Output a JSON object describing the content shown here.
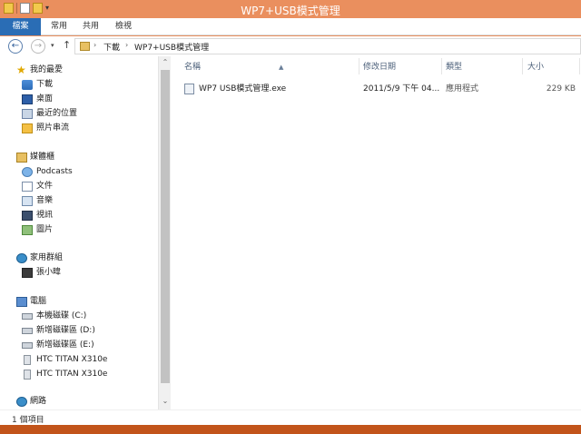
{
  "window": {
    "title": "WP7+USB模式管理"
  },
  "ribbon": {
    "tabs": [
      "檔案",
      "常用",
      "共用",
      "檢視"
    ]
  },
  "address": {
    "crumbs": [
      "下載",
      "WP7+USB模式管理"
    ]
  },
  "nav": {
    "favorites": {
      "header": "我的最愛",
      "items": [
        "下載",
        "桌面",
        "最近的位置",
        "照片串流"
      ]
    },
    "libraries": {
      "header": "媒體櫃",
      "items": [
        "Podcasts",
        "文件",
        "音樂",
        "視訊",
        "圖片"
      ]
    },
    "homegroup": {
      "header": "家用群組",
      "items": [
        "張小暐"
      ]
    },
    "computer": {
      "header": "電腦",
      "items": [
        "本機磁碟 (C:)",
        "新增磁碟區 (D:)",
        "新增磁碟區 (E:)",
        "HTC TITAN X310e",
        "HTC TITAN X310e"
      ]
    },
    "network": {
      "header": "網路"
    }
  },
  "columns": {
    "name": "名稱",
    "date": "修改日期",
    "type": "類型",
    "size": "大小"
  },
  "files": [
    {
      "name": "WP7 USB模式管理.exe",
      "date": "2011/5/9 下午 04...",
      "type": "應用程式",
      "size": "229 KB"
    }
  ],
  "status": {
    "count": "1 個項目"
  },
  "colors": {
    "title_bar": "#ea8f5e",
    "file_tab": "#2a6db5",
    "taskbar": "#c2541a"
  }
}
